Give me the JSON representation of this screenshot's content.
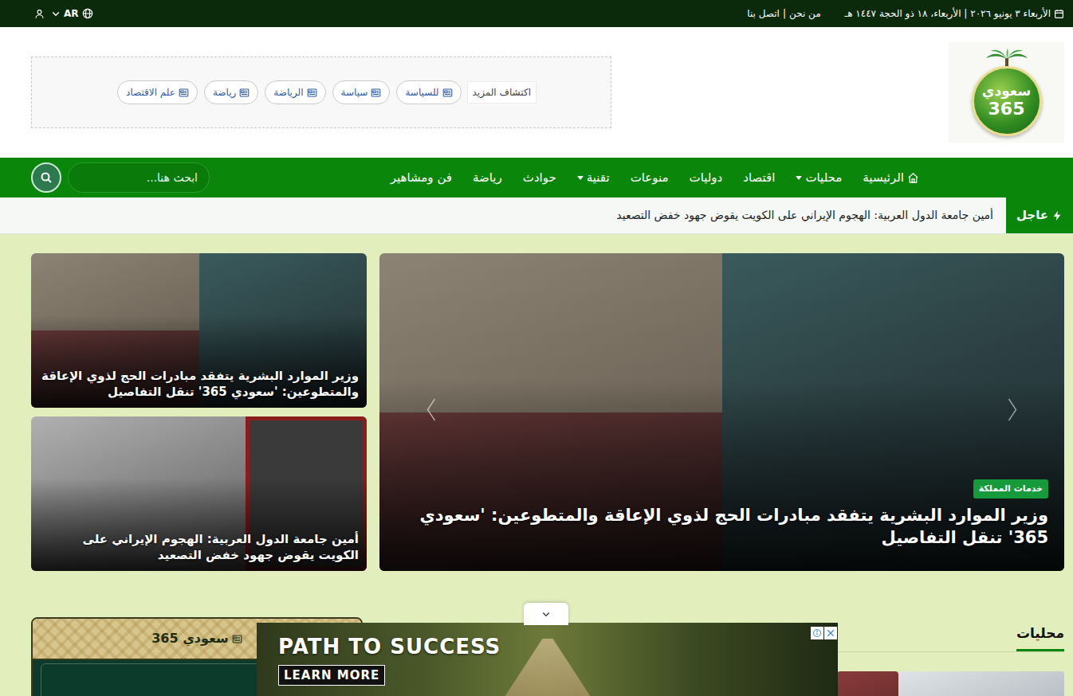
{
  "topbar": {
    "date": "الأربعاء ٣ يونيو ٢٠٢٦ | الأربعاء، ١٨ ذو الحجة ١٤٤٧ هـ",
    "links": [
      "من نحن",
      "اتصل بنا"
    ],
    "separator": "|",
    "language": "AR"
  },
  "logo": {
    "word": "سعودي",
    "number": "365"
  },
  "discover": {
    "label": "اكتشاف المزيد",
    "tags": [
      "للسياسة",
      "سياسة",
      "الرياضة",
      "رياضة",
      "علم الاقتصاد"
    ]
  },
  "nav": {
    "items": [
      {
        "label": "الرئيسية",
        "kind": "home",
        "has_menu": false
      },
      {
        "label": "محليات",
        "kind": "link",
        "has_menu": true
      },
      {
        "label": "اقتصاد",
        "kind": "link",
        "has_menu": false
      },
      {
        "label": "دوليات",
        "kind": "link",
        "has_menu": false
      },
      {
        "label": "منوعات",
        "kind": "link",
        "has_menu": false
      },
      {
        "label": "تقنية",
        "kind": "link",
        "has_menu": true
      },
      {
        "label": "حوادث",
        "kind": "link",
        "has_menu": false
      },
      {
        "label": "رياضة",
        "kind": "link",
        "has_menu": false
      },
      {
        "label": "فن ومشاهير",
        "kind": "link",
        "has_menu": false
      }
    ],
    "search": {
      "placeholder": "ابحث هنا..."
    }
  },
  "breaking": {
    "label": "عاجل",
    "text": "أمين جامعة الدول العربية: الهجوم الإيراني على الكويت يقوض جهود خفض التصعيد"
  },
  "slider": {
    "category": "خدمات المملكة",
    "title": "وزير الموارد البشرية يتفقد مبادرات الحج لذوي الإعاقة والمتطوعين: 'سعودي 365' تنقل التفاصيل"
  },
  "side_cards": [
    {
      "title": "وزير الموارد البشرية يتفقد مبادرات الحج لذوي الإعاقة والمتطوعين: 'سعودي 365' تنقل التفاصيل"
    },
    {
      "title": "أمين جامعة الدول العربية: الهجوم الإيراني على الكويت يقوض جهود خفض التصعيد"
    }
  ],
  "widget": {
    "title": "سعودي 365"
  },
  "section": {
    "title": "محليات"
  },
  "ad": {
    "headline": "PATH TO SUCCESS",
    "cta": "LEARN MORE"
  }
}
